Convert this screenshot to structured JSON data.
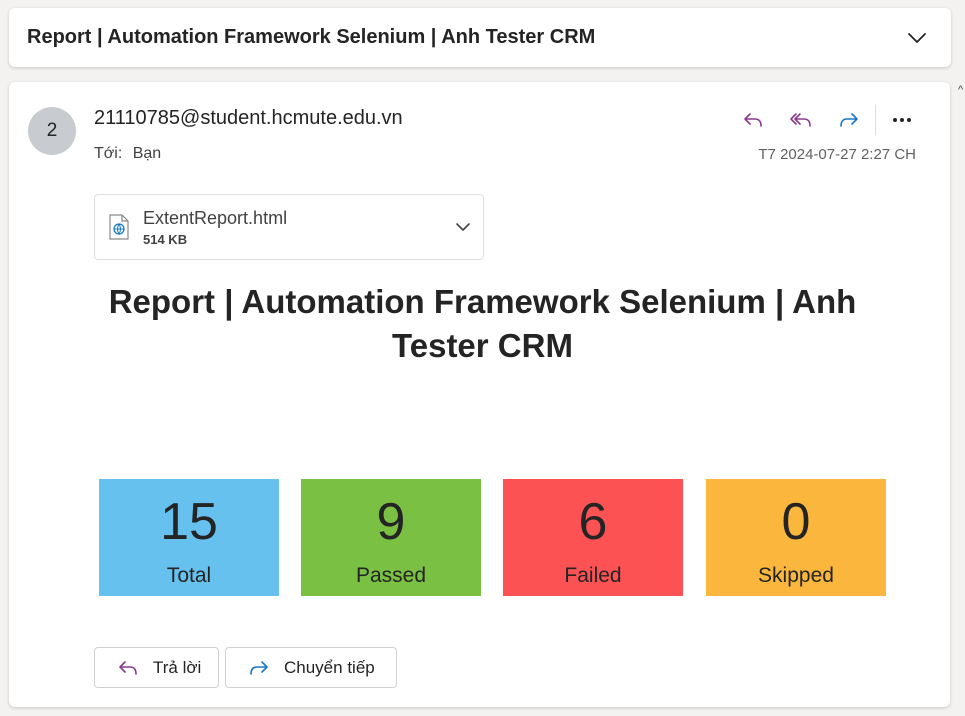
{
  "subject": {
    "title": "Report | Automation Framework Selenium | Anh Tester CRM",
    "collapse_icon": "chevron-down-icon"
  },
  "message": {
    "avatar_text": "2",
    "sender": "21110785@student.hcmute.edu.vn",
    "to_label": "Tới:",
    "to_value": "Bạn",
    "date": "T7 2024-07-27 2:27 CH",
    "actions": {
      "reply_icon": "reply-icon",
      "reply_all_icon": "reply-all-icon",
      "forward_icon": "forward-icon",
      "more_icon": "more-icon"
    }
  },
  "attachment": {
    "name": "ExtentReport.html",
    "size": "514 KB",
    "icon": "html-file-icon"
  },
  "report": {
    "title": "Report | Automation Framework Selenium | Anh Tester CRM",
    "stats": [
      {
        "value": "15",
        "label": "Total",
        "color": "#66c1ef"
      },
      {
        "value": "9",
        "label": "Passed",
        "color": "#7ac143"
      },
      {
        "value": "6",
        "label": "Failed",
        "color": "#fd5253"
      },
      {
        "value": "0",
        "label": "Skipped",
        "color": "#fbb73d"
      }
    ]
  },
  "footer": {
    "reply_label": "Trả lời",
    "forward_label": "Chuyển tiếp"
  },
  "colors": {
    "reply_purple": "#8a3a8f",
    "forward_blue": "#1a78c2"
  }
}
